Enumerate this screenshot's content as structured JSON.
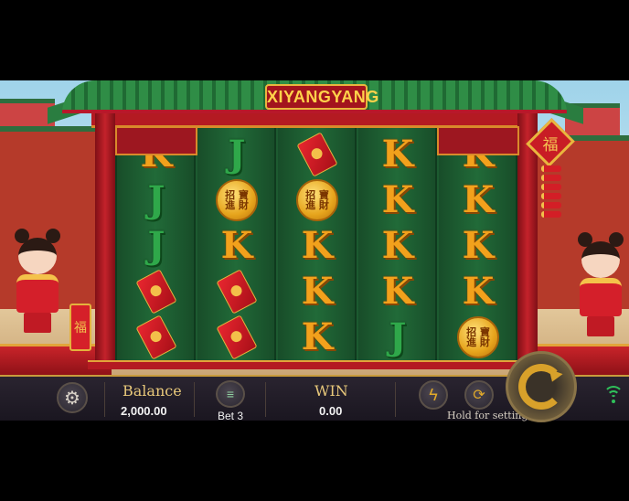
{
  "game": {
    "title": "XIYANGYANG",
    "lantern_glyph": "福",
    "firecracker_glyph": "福"
  },
  "reels": [
    [
      "K",
      "J",
      "J",
      "envelope",
      "envelope"
    ],
    [
      "J",
      "coin",
      "K",
      "envelope",
      "envelope"
    ],
    [
      "envelope",
      "coin",
      "K",
      "K",
      "K"
    ],
    [
      "K",
      "K",
      "K",
      "K",
      "J"
    ],
    [
      "K",
      "K",
      "K",
      "K",
      "coin"
    ]
  ],
  "symbols": {
    "coin_text": "招 寶\n進 財",
    "K": "K",
    "J": "J"
  },
  "bottom_bar": {
    "balance_label": "Balance",
    "balance_value": "2,000.00",
    "bet_label": "Bet 3",
    "win_label": "WIN",
    "win_value": "0.00",
    "hold_label": "Hold for setting"
  },
  "icons": {
    "settings": "gear-icon",
    "bet": "coin-stack-icon",
    "turbo": "lightning-icon",
    "autoplay": "autoplay-icon",
    "spin": "spin-icon",
    "connection": "wifi-icon"
  },
  "colors": {
    "accent_gold": "#e8c87a",
    "reel_green": "#1c5a30",
    "frame_red": "#b41a22",
    "wifi_green": "#2fc15a"
  }
}
